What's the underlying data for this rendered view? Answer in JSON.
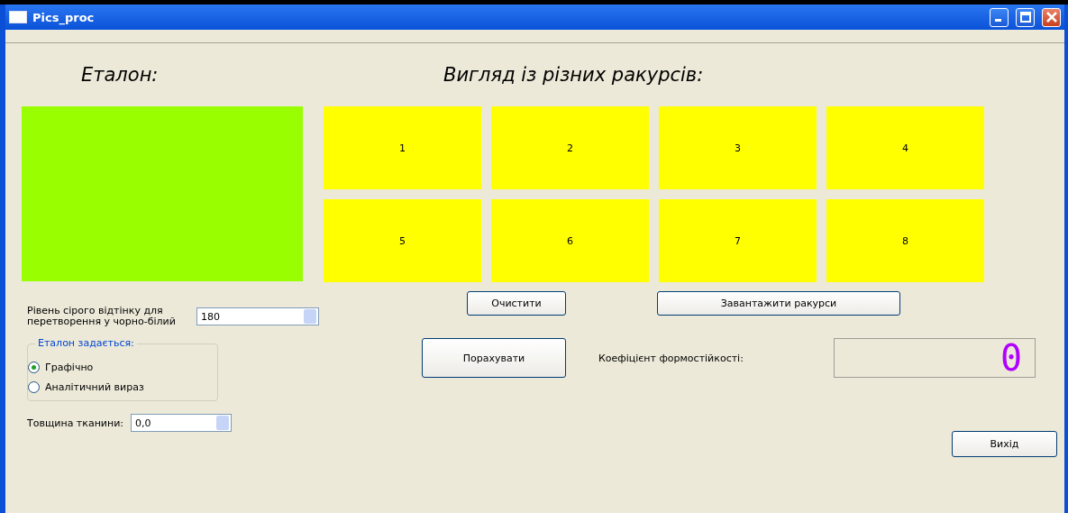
{
  "window": {
    "title": "Pics_proc"
  },
  "reference": {
    "heading": "Еталон:"
  },
  "views": {
    "heading": "Вигляд із різних ракурсів:",
    "tiles": [
      "1",
      "2",
      "3",
      "4",
      "5",
      "6",
      "7",
      "8"
    ]
  },
  "gray_level": {
    "label": "Рівень сірого відтінку для перетворення у чорно-білий",
    "value": "180"
  },
  "reference_mode": {
    "title": "Еталон задається:",
    "options": [
      {
        "label": "Графічно",
        "selected": true
      },
      {
        "label": "Аналітичний вираз",
        "selected": false
      }
    ]
  },
  "thickness": {
    "label": "Товщина тканини:",
    "value": "0,0"
  },
  "buttons": {
    "clear": "Очистити",
    "load": "Завантажити ракурси",
    "compute": "Порахувати",
    "exit": "Вихід"
  },
  "coefficient": {
    "label": "Коефіцієнт формостійкості:",
    "value": "0"
  }
}
